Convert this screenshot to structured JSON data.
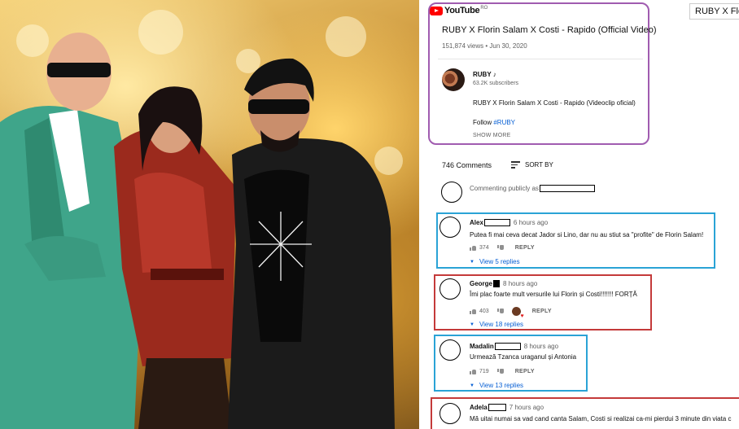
{
  "youtube": {
    "logo_text": "YouTube",
    "region": "RO",
    "search_value": "RUBY X Flor"
  },
  "video": {
    "title": "RUBY X Florin Salam X Costi - Rapido (Official Video)",
    "views": "151,874 views",
    "date": "Jun 30, 2020",
    "meta_separator": " • "
  },
  "channel": {
    "name": "RUBY ♪",
    "subscribers": "63.2K subscribers"
  },
  "description": {
    "line1": "RUBY X Florin Salam X Costi - Rapido (Videoclip oficial)",
    "follow_label": "Follow ",
    "follow_tag": "#RUBY",
    "show_more": "SHOW MORE"
  },
  "comments_header": {
    "count": "746 Comments",
    "sort_label": "SORT BY",
    "public_prefix": "Commenting publicly as"
  },
  "comments": [
    {
      "author": "Alex",
      "time": "6 hours ago",
      "text": "Putea fi mai ceva decat Jador si Lino, dar nu au stiut sa \"profite\" de Florin Salam!",
      "likes": "374",
      "reply": "REPLY",
      "replies": "View 5 replies",
      "frame": "blue"
    },
    {
      "author": "George",
      "time": "8 hours ago",
      "text": "Îmi plac foarte mult versurile lui Florin și Costi!!!!!!!     FORȚĂ",
      "likes": "403",
      "reply": "REPLY",
      "replies": "View 18 replies",
      "frame": "red"
    },
    {
      "author": "Madalin",
      "time": "8 hours ago",
      "text": "Urmează Tzanca uraganul și Antonia",
      "likes": "719",
      "reply": "REPLY",
      "replies": "View 13 replies",
      "frame": "blue"
    },
    {
      "author": "Adela",
      "time": "7 hours ago",
      "text": "Mă uitai numai sa vad cand canta Salam, Costi si realizai ca-mi pierdui 3 minute din viata c",
      "frame": "red"
    }
  ],
  "colors": {
    "purple_frame": "#a05cb0",
    "blue_frame": "#2aa3d6",
    "red_frame": "#c43a3a",
    "link": "#065fd4",
    "youtube_red": "#ff0000"
  }
}
